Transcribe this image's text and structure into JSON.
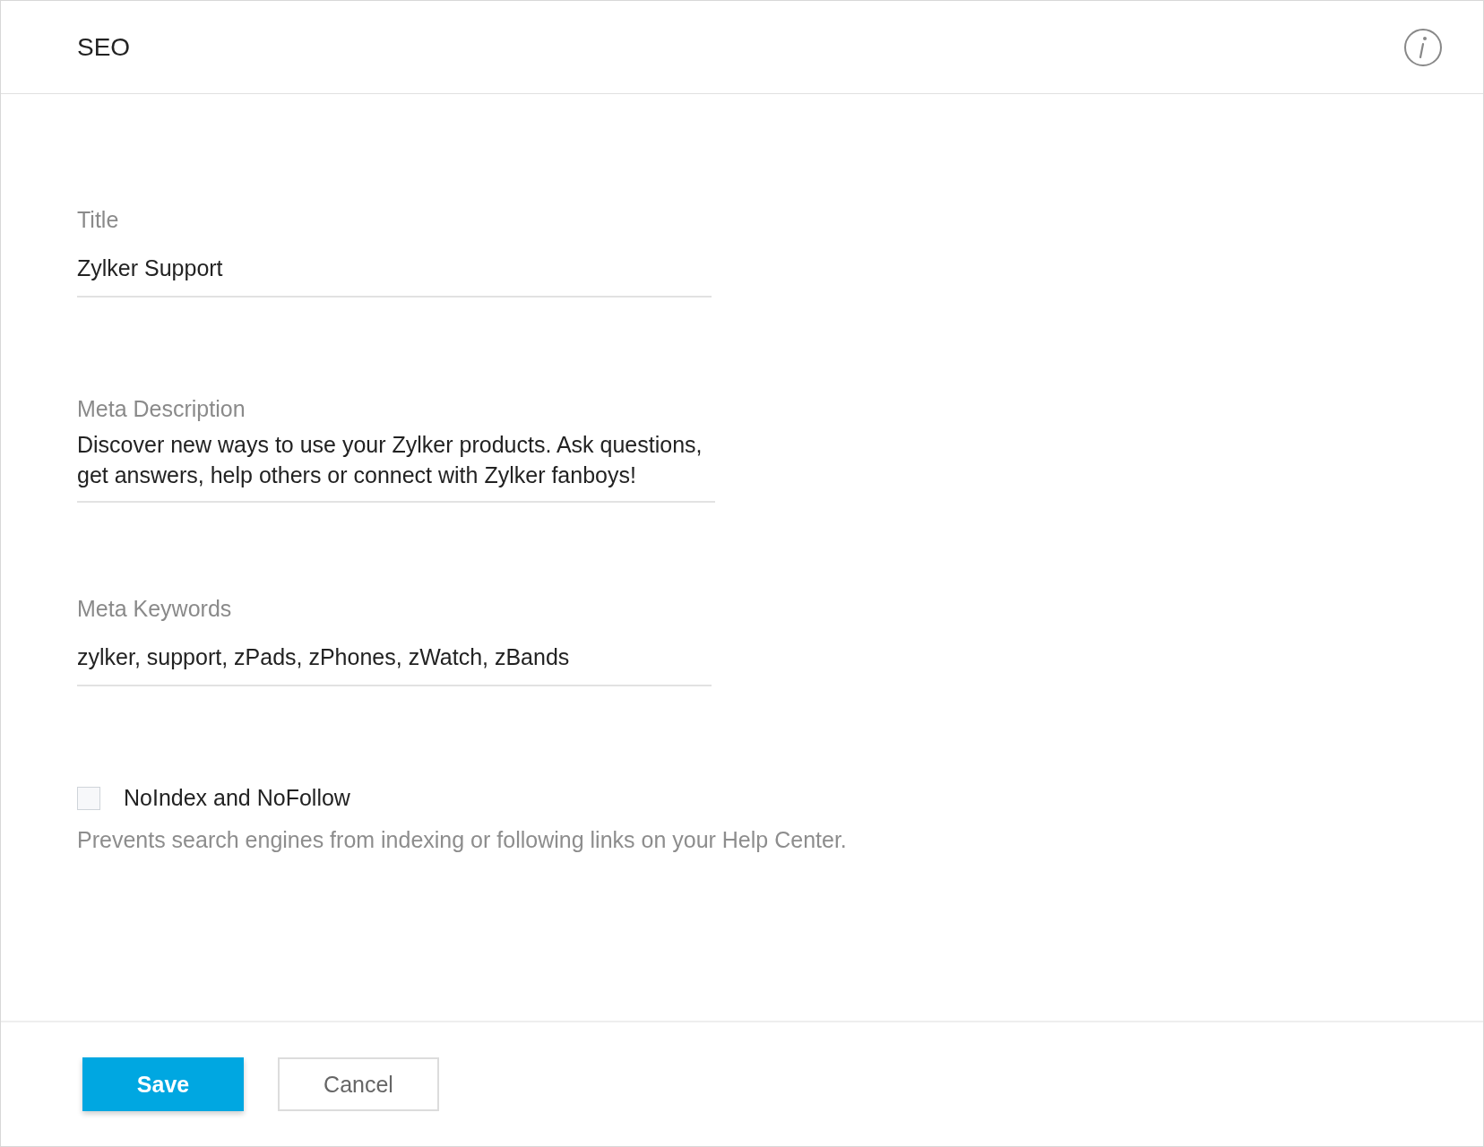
{
  "header": {
    "title": "SEO"
  },
  "fields": [
    {
      "label": "Title",
      "value": "Zylker Support"
    },
    {
      "label": "Meta Description",
      "value": "Discover new ways to use your Zylker products. Ask questions, get answers, help others or connect with Zylker fanboys!"
    },
    {
      "label": "Meta Keywords",
      "value": "zylker, support, zPads, zPhones, zWatch, zBands"
    }
  ],
  "option": {
    "label": "NoIndex and NoFollow",
    "checked": false,
    "hint": "Prevents search engines from indexing or following links on your Help Center."
  },
  "buttons": [
    {
      "label": "Save",
      "kind": "primary"
    },
    {
      "label": "Cancel",
      "kind": "secondary"
    }
  ]
}
